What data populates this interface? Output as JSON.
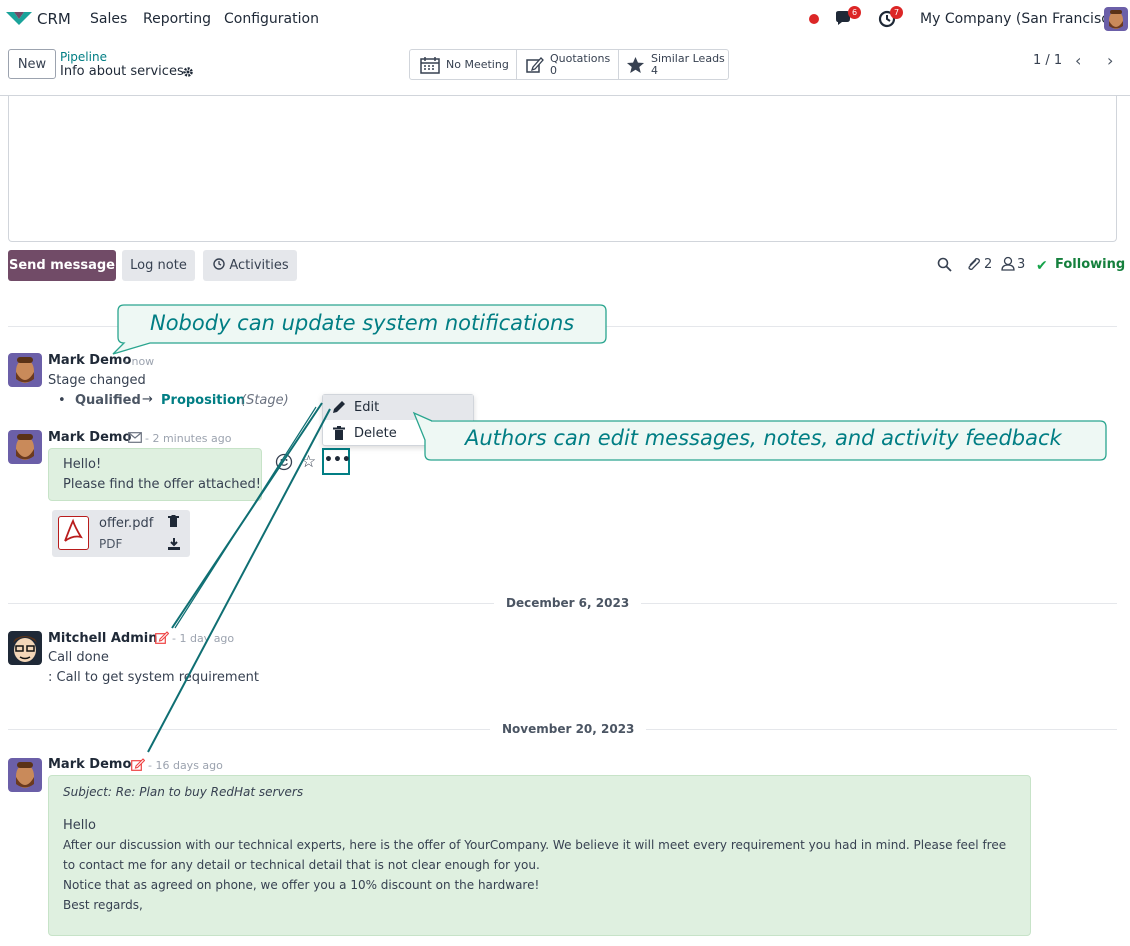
{
  "nav": {
    "app": "CRM",
    "menu": [
      "Sales",
      "Reporting",
      "Configuration"
    ],
    "messages_badge": "6",
    "activities_badge": "7",
    "company": "My Company (San Francisco)"
  },
  "control": {
    "new_label": "New",
    "breadcrumb": "Pipeline",
    "record_title": "Info about services",
    "smart_buttons": {
      "meeting": "No Meeting",
      "quotations_label": "Quotations",
      "quotations_count": "0",
      "similar_label": "Similar Leads",
      "similar_count": "4"
    },
    "pager": "1 / 1"
  },
  "composer": {
    "send_message": "Send message",
    "log_note": "Log note",
    "activities": "Activities",
    "attachments_count": "2",
    "followers_count": "3",
    "following": "Following"
  },
  "callouts": {
    "system": "Nobody can update system notifications",
    "authors": "Authors can edit messages, notes, and activity feedback"
  },
  "menu": {
    "edit": "Edit",
    "delete": "Delete"
  },
  "messages": [
    {
      "author": "Mark Demo",
      "time": "- now",
      "body": "Stage changed",
      "tracking_old": "Qualified",
      "tracking_new": "Proposition",
      "tracking_field": "(Stage)"
    },
    {
      "author": "Mark Demo",
      "time": "- 2 minutes ago",
      "line1": "Hello!",
      "line2": "Please find the offer attached!",
      "attachment_name": "offer.pdf",
      "attachment_type": "PDF"
    },
    {
      "author": "Mitchell Admin",
      "time": "- 1 day ago",
      "line1": "Call done",
      "line2": ": Call to get system requirement"
    },
    {
      "author": "Mark Demo",
      "time": "- 16 days ago",
      "subject": "Subject: Re: Plan to buy RedHat servers",
      "line1": "Hello",
      "line2": "After our discussion with our technical experts, here is the offer of YourCompany. We believe it will meet every requirement you had in mind. Please feel free",
      "line3": "to contact me for any detail or technical detail that is not clear enough for you.",
      "line4": "Notice that as agreed on phone, we offer you a 10% discount on the hardware!",
      "line5": "Best regards,"
    }
  ],
  "dates": {
    "dec": "December 6, 2023",
    "nov": "November 20, 2023"
  },
  "colors": {
    "brand": "#714b67",
    "accent": "#017e84",
    "bubble": "#dff0e0",
    "callout_fill": "#eef8f4"
  }
}
